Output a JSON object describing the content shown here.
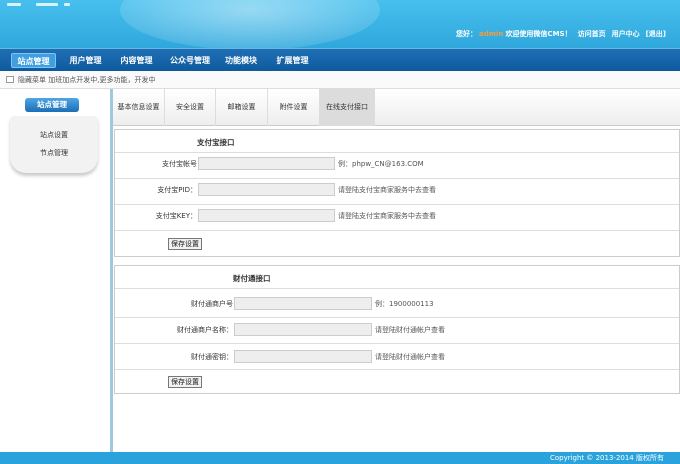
{
  "header": {
    "greeting": "您好：",
    "username": "admin",
    "welcome": "欢迎使用微信CMS！",
    "links": [
      "访问首页",
      "用户中心",
      "[退出]"
    ]
  },
  "nav": {
    "items": [
      "站点管理",
      "用户管理",
      "内容管理",
      "公众号管理",
      "功能模块",
      "扩展管理"
    ],
    "active_index": 0
  },
  "breadcrumb": {
    "text": "隐藏菜单 加班加点开发中,更多功能，开发中"
  },
  "sidebar": {
    "title": "站点管理",
    "items": [
      "站点设置",
      "节点管理"
    ]
  },
  "tabs": {
    "items": [
      "基本信息设置",
      "安全设置",
      "邮箱设置",
      "附件设置",
      "在线支付接口"
    ],
    "active_index": 4
  },
  "alipay": {
    "title": "支付宝接口",
    "fields": [
      {
        "label": "支付宝帐号",
        "value": "",
        "hint": "例：phpw_CN@163.COM"
      },
      {
        "label": "支付宝PID：",
        "value": "",
        "hint": "请登陆支付宝商家服务中去查看"
      },
      {
        "label": "支付宝KEY：",
        "value": "",
        "hint": "请登陆支付宝商家服务中去查看"
      }
    ],
    "save_label": "保存设置"
  },
  "tenpay": {
    "title": "财付通接口",
    "fields": [
      {
        "label": "财付通商户号",
        "value": "",
        "hint": "例：1900000113"
      },
      {
        "label": "财付通商户名称：",
        "value": "",
        "hint": "请登陆财付通帐户查看"
      },
      {
        "label": "财付通密钥：",
        "value": "",
        "hint": "请登陆财付通帐户查看"
      }
    ],
    "save_label": "保存设置"
  },
  "footer": {
    "copyright": "Copyright © 2013-2014 版权所有"
  }
}
